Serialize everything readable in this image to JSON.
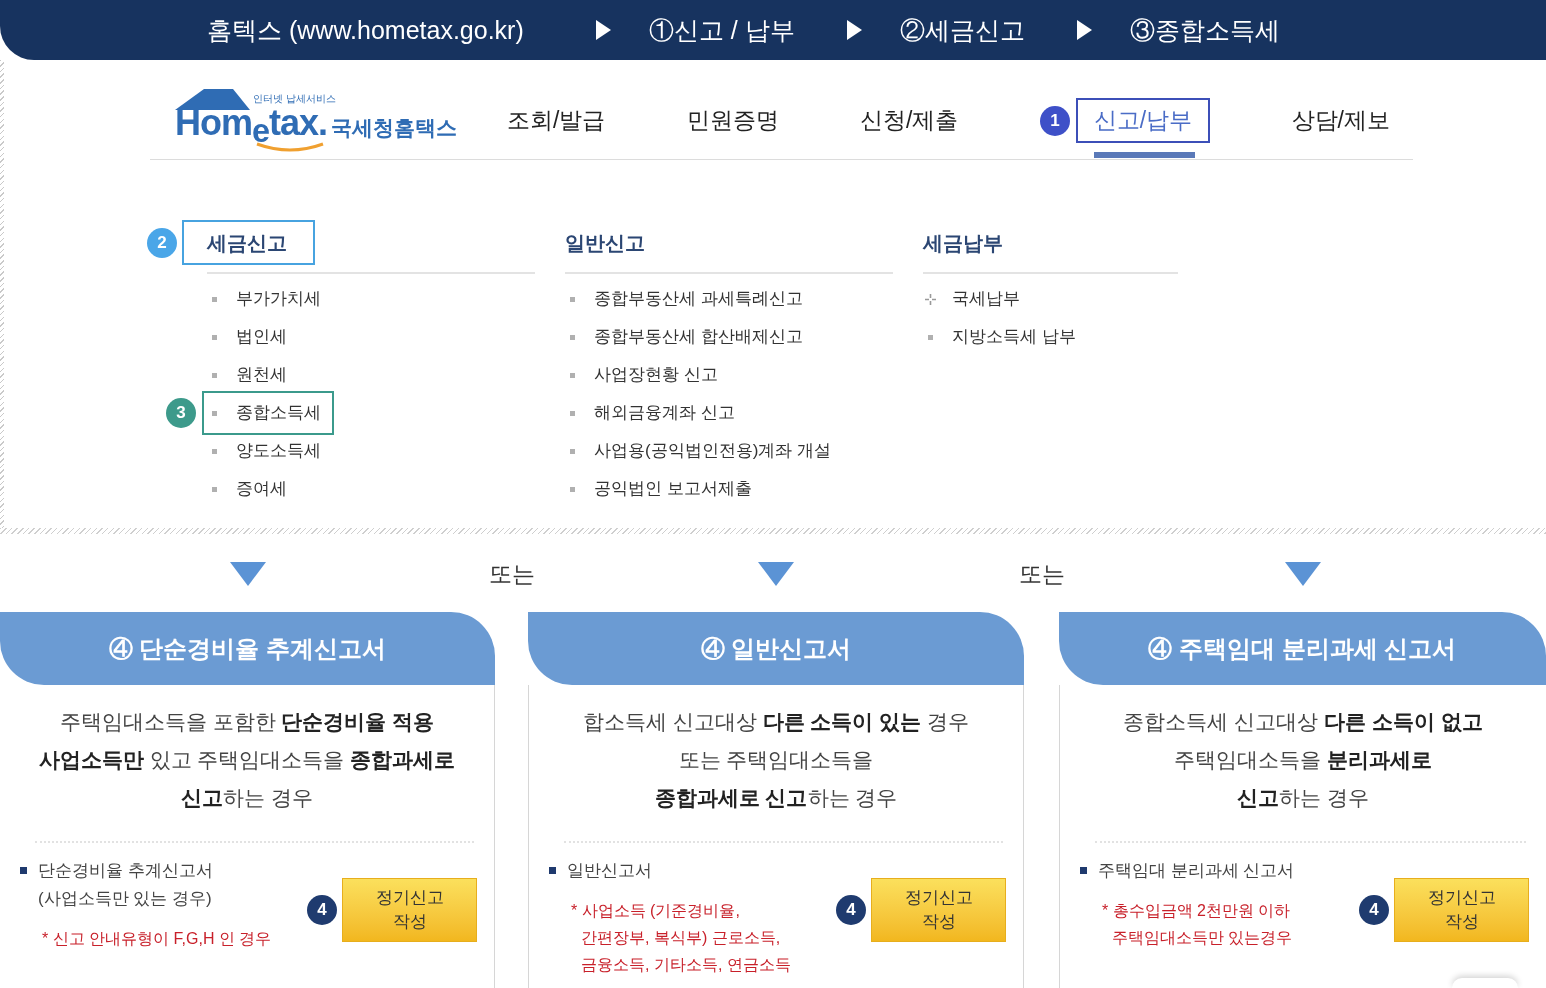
{
  "banner": {
    "breadcrumbs": [
      "홈텍스 (www.hometax.go.kr)",
      "①신고 / 납부",
      "②세금신고",
      "③종합소득세"
    ]
  },
  "header": {
    "logo": {
      "tagline": "인터넷 납세서비스",
      "wordmark": "Hom$_{e}$tax.",
      "name": "국세청홈택스"
    },
    "nav": [
      {
        "label": "조회/발급",
        "selected": false
      },
      {
        "label": "민원증명",
        "selected": false
      },
      {
        "label": "신청/제출",
        "selected": false
      },
      {
        "label": "신고/납부",
        "selected": true,
        "badge": "1"
      },
      {
        "label": "상담/제보",
        "selected": false
      }
    ]
  },
  "menu": {
    "columns": [
      {
        "heading": "세금신고",
        "selected": true,
        "badge": "2",
        "items": [
          {
            "label": "부가가치세",
            "selected": false
          },
          {
            "label": "법인세",
            "selected": false
          },
          {
            "label": "원천세",
            "selected": false
          },
          {
            "label": "종합소득세",
            "selected": true,
            "badge": "3"
          },
          {
            "label": "양도소득세",
            "selected": false
          },
          {
            "label": "증여세",
            "selected": false
          }
        ]
      },
      {
        "heading": "일반신고",
        "selected": false,
        "items": [
          {
            "label": "종합부동산세 과세특례신고",
            "selected": false
          },
          {
            "label": "종합부동산세 합산배제신고",
            "selected": false
          },
          {
            "label": "사업장현황 신고",
            "selected": false
          },
          {
            "label": "해외금융계좌 신고",
            "selected": false
          },
          {
            "label": "사업용(공익법인전용)계좌 개설",
            "selected": false
          },
          {
            "label": "공익법인 보고서제출",
            "selected": false
          }
        ]
      },
      {
        "heading": "세금납부",
        "selected": false,
        "items": [
          {
            "label": "국세납부",
            "selected": false,
            "kind": "expandable"
          },
          {
            "label": "지방소득세 납부",
            "selected": false,
            "kind": "plain"
          }
        ]
      }
    ]
  },
  "separators": [
    "또는",
    "또는"
  ],
  "cards": [
    {
      "title": "④ 단순경비율 추계신고서",
      "description": "주택임대소득을 포함한 **단순경비율 적용**\n**사업소득만** 있고 주택임대소득을 **종합과세로**\n**신고**하는 경우",
      "form": "단순경비율 추계신고서\n(사업소득만 있는 경우)",
      "note": "* 신고 안내유형이 F,G,H 인 경우",
      "badge": "4",
      "button": "정기신고\n작성"
    },
    {
      "title": "④ 일반신고서",
      "description": "합소득세 신고대상 **다른 소득이 있는** 경우\n또는 주택임대소득을\n**종합과세로 신고**하는 경우",
      "form": "일반신고서",
      "note": "* 사업소득 (기준경비율,\n간편장부, 복식부) 근로소득,\n금융소득, 기타소득, 연금소득",
      "badge": "4",
      "button": "정기신고\n작성"
    },
    {
      "title": "④ 주택임대 분리과세 신고서",
      "description": "종합소득세 신고대상 **다른 소득이 없고**\n주택임대소득을 **분리과세로**\n**신고**하는 경우",
      "form": "주택임대 분리과세 신고서",
      "note": "* 총수입금액 2천만원 이하\n주택임대소득만 있는경우",
      "badge": "4",
      "button": "정기신고\n작성"
    }
  ]
}
